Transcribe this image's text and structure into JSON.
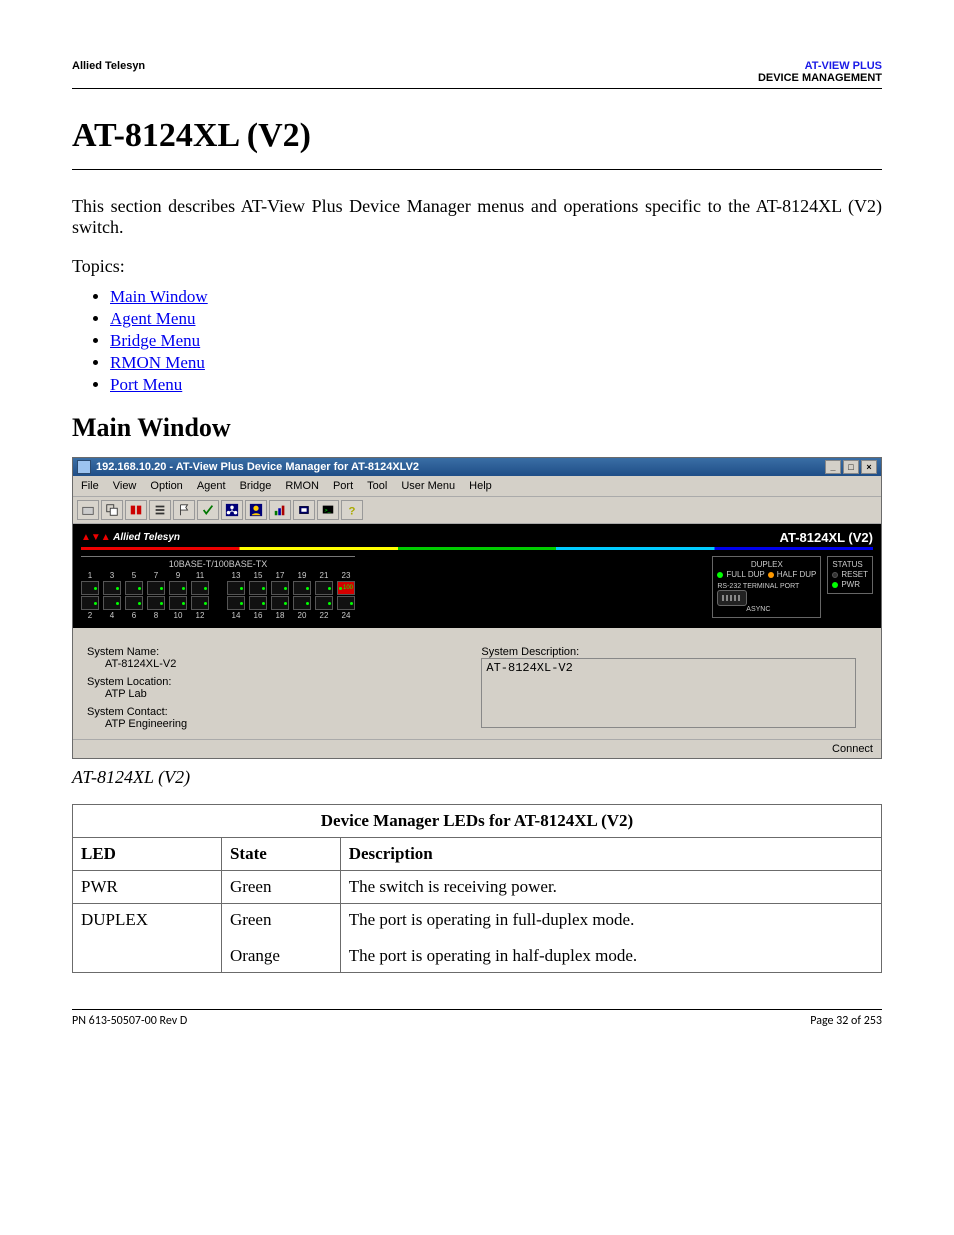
{
  "header": {
    "left": "Allied Telesyn",
    "right_top": "AT-VIEW PLUS",
    "right_bottom": "DEVICE MANAGEMENT"
  },
  "title": "AT-8124XL (V2)",
  "intro": "This section describes AT-View Plus Device Manager menus and operations specific to the AT-8124XL (V2) switch.",
  "topics_label": "Topics:",
  "topics": [
    "Main Window",
    "Agent Menu",
    "Bridge Menu",
    "RMON Menu",
    "Port Menu"
  ],
  "h2": "Main Window",
  "app": {
    "title": "192.168.10.20 - AT-View Plus Device Manager for AT-8124XLV2",
    "win_min": "_",
    "win_max": "□",
    "win_close": "×",
    "menus": [
      "File",
      "View",
      "Option",
      "Agent",
      "Bridge",
      "RMON",
      "Port",
      "Tool",
      "User Menu",
      "Help"
    ],
    "brand": "Allied Telesyn",
    "model": "AT-8124XL (V2)",
    "port_label": "10BASE-T/100BASE-TX",
    "ports_top": [
      "1",
      "3",
      "5",
      "7",
      "9",
      "11",
      "13",
      "15",
      "17",
      "19",
      "21",
      "23"
    ],
    "ports_bottom": [
      "2",
      "4",
      "6",
      "8",
      "10",
      "12",
      "14",
      "16",
      "18",
      "20",
      "22",
      "24"
    ],
    "duplex_title": "DUPLEX",
    "duplex_full": "FULL DUP",
    "duplex_half": "HALF DUP",
    "term_label": "RS-232 TERMINAL PORT",
    "async_label": "ASYNC",
    "status_title": "STATUS",
    "reset_label": "RESET",
    "pwr_label": "PWR",
    "sys_name_lbl": "System Name:",
    "sys_name_val": "AT-8124XL-V2",
    "sys_loc_lbl": "System Location:",
    "sys_loc_val": "ATP Lab",
    "sys_contact_lbl": "System Contact:",
    "sys_contact_val": "ATP Engineering",
    "sys_desc_lbl": "System Description:",
    "sys_desc_val": "AT-8124XL-V2",
    "statusbar": "Connect"
  },
  "caption": "AT-8124XL (V2)",
  "led_table": {
    "caption": "Device Manager LEDs for AT-8124XL (V2)",
    "headers": [
      "LED",
      "State",
      "Description"
    ],
    "rows": [
      {
        "led": "PWR",
        "states": [
          "Green"
        ],
        "descs": [
          "The switch is receiving power."
        ]
      },
      {
        "led": "DUPLEX",
        "states": [
          "Green",
          "Orange"
        ],
        "descs": [
          "The port is operating in full-duplex mode.",
          "The port is operating in half-duplex mode."
        ]
      }
    ]
  },
  "footer": {
    "left": "PN 613-50507-00 Rev D",
    "right": "Page 32 of 253"
  }
}
